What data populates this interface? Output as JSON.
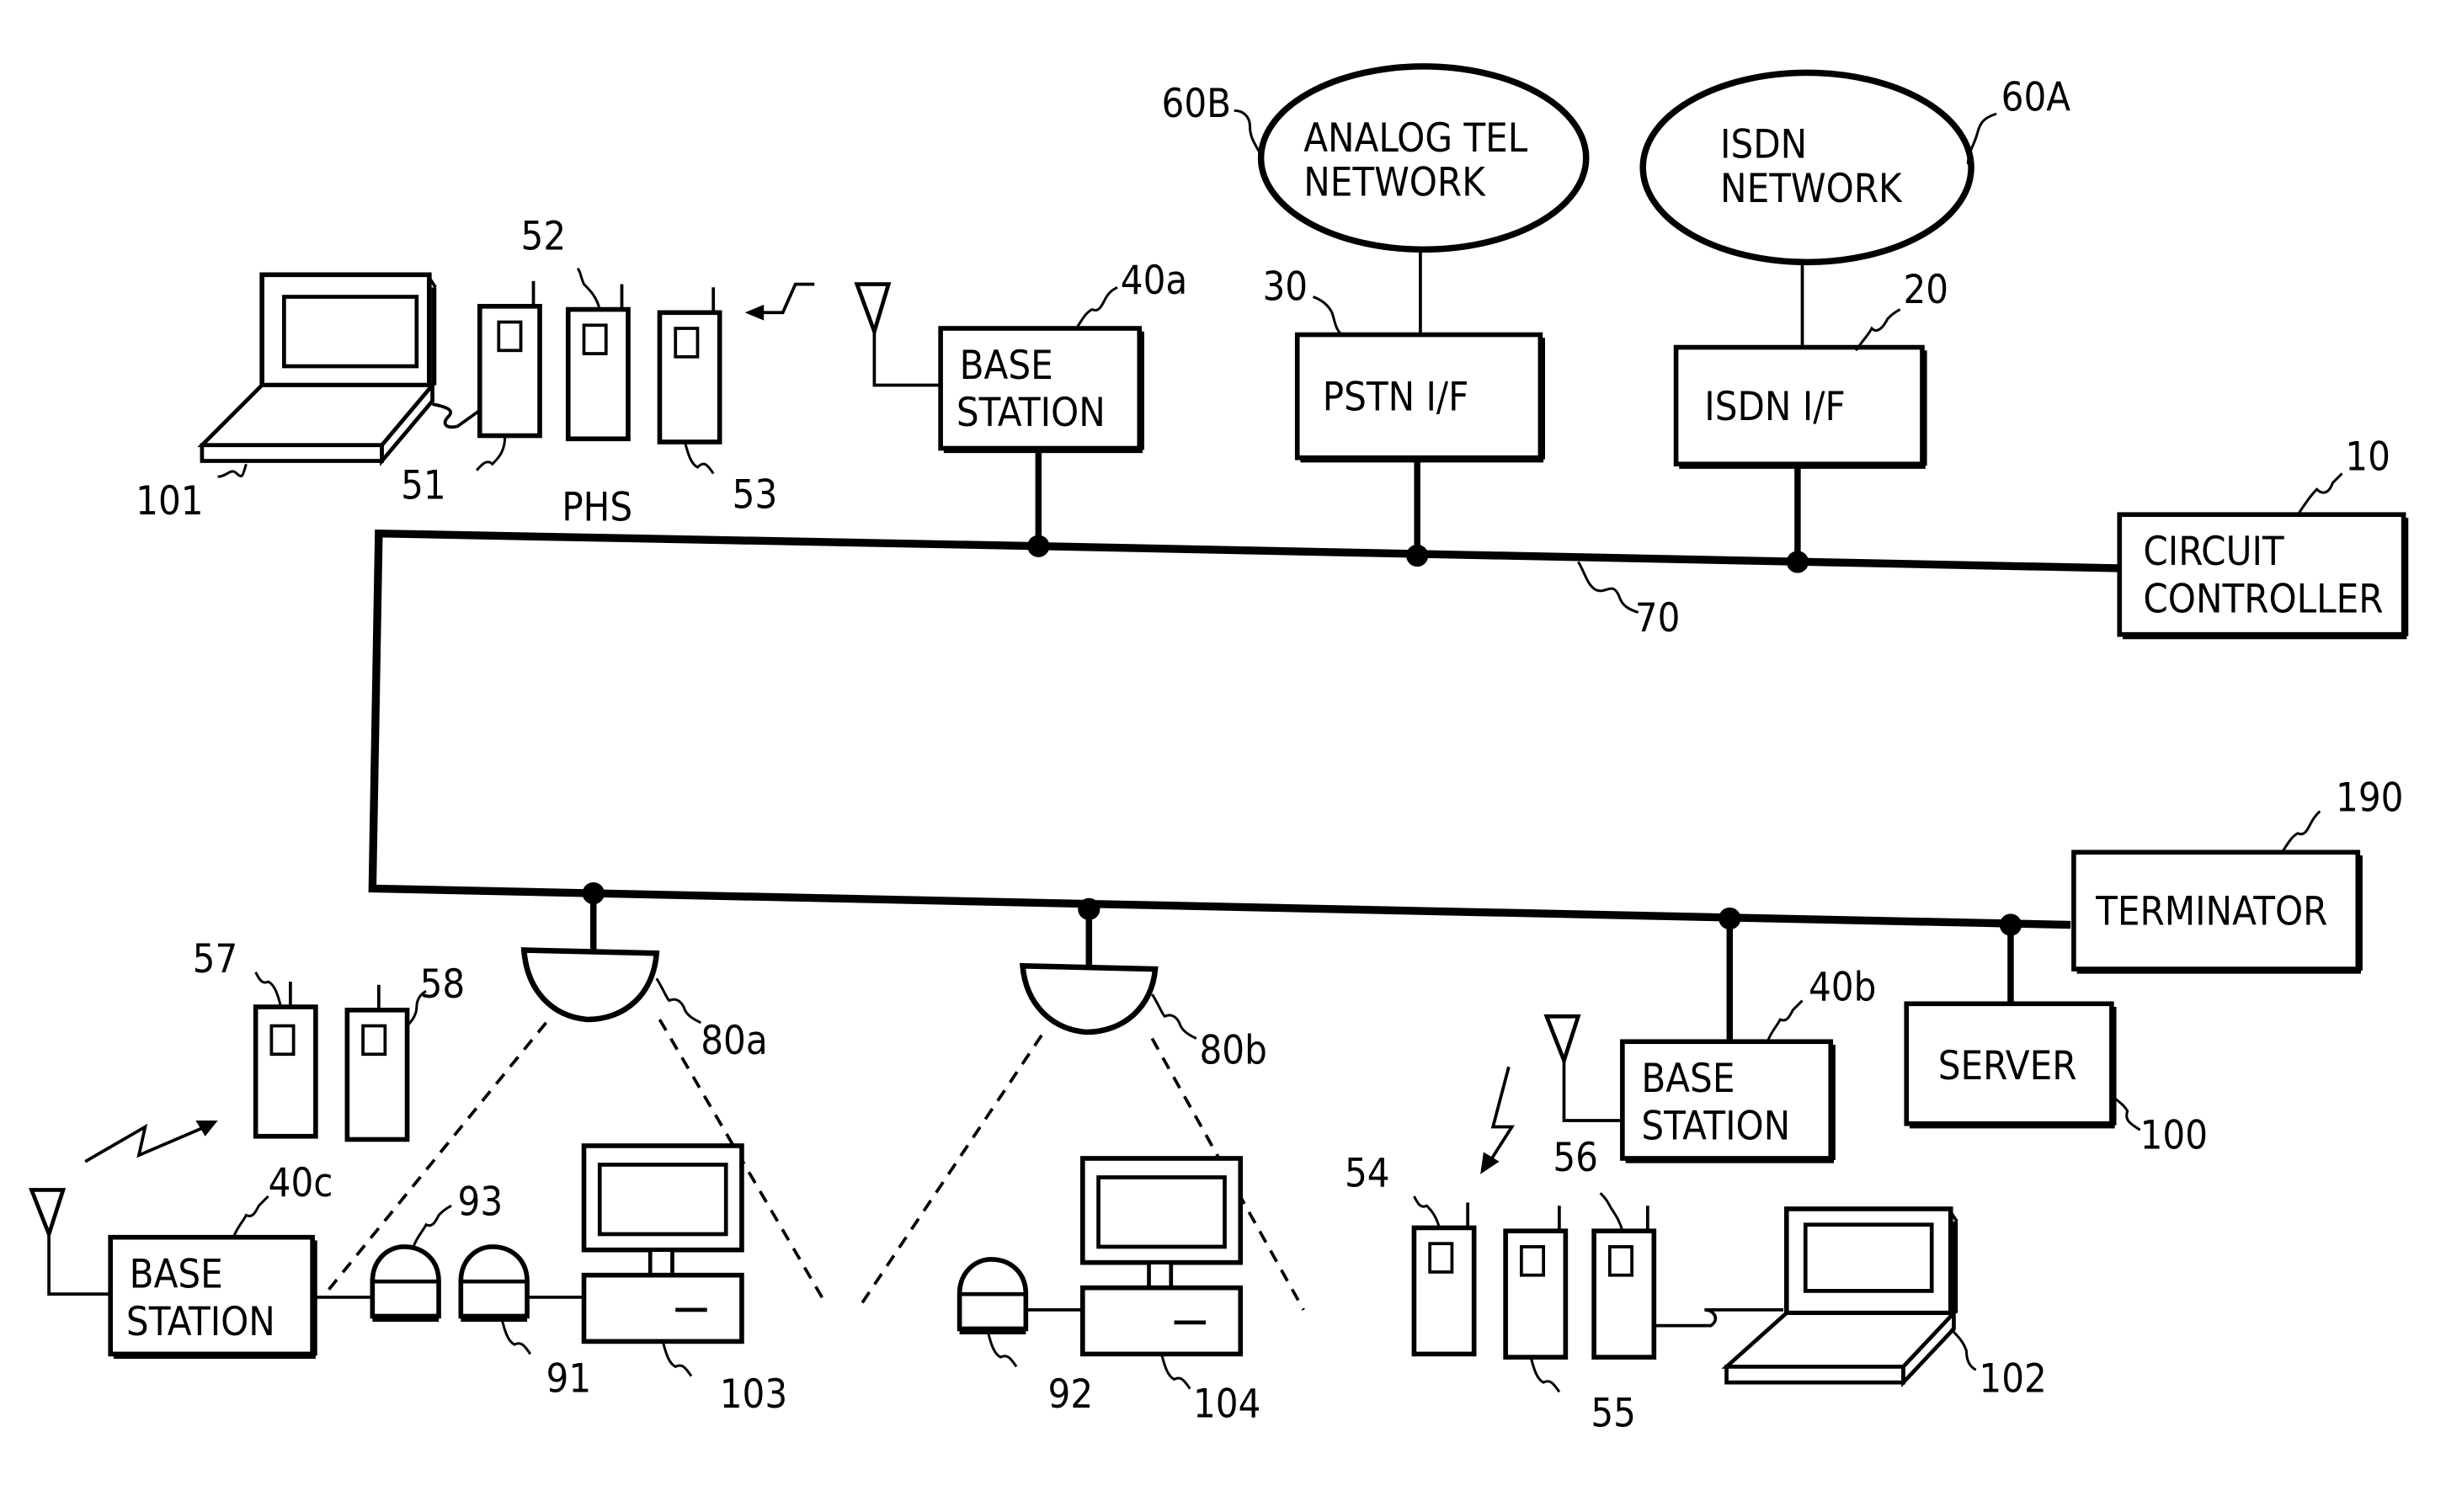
{
  "figure": {
    "type": "network block diagram",
    "bus_label": "70",
    "nodes": {
      "analog_net": {
        "ref": "60B",
        "lines": [
          "ANALOG TEL",
          "NETWORK"
        ]
      },
      "isdn_net": {
        "ref": "60A",
        "lines": [
          "ISDN",
          "NETWORK"
        ]
      },
      "pstn_if": {
        "ref": "30",
        "label": "PSTN I/F"
      },
      "isdn_if": {
        "ref": "20",
        "label": "ISDN I/F"
      },
      "circuit_controller": {
        "ref": "10",
        "lines": [
          "CIRCUIT",
          "CONTROLLER"
        ]
      },
      "terminator": {
        "ref": "190",
        "label": "TERMINATOR"
      },
      "server": {
        "ref": "100",
        "label": "SERVER"
      },
      "base_station_a": {
        "ref": "40a",
        "lines": [
          "BASE",
          "STATION"
        ]
      },
      "base_station_b": {
        "ref": "40b",
        "lines": [
          "BASE",
          "STATION"
        ]
      },
      "base_station_c": {
        "ref": "40c",
        "lines": [
          "BASE",
          "STATION"
        ]
      },
      "transceiver_a": {
        "ref": "80a"
      },
      "transceiver_b": {
        "ref": "80b"
      }
    },
    "phs_group_label": "PHS",
    "phones": {
      "p51": "51",
      "p52": "52",
      "p53": "53",
      "p54": "54",
      "p55": "55",
      "p56": "56",
      "p57": "57",
      "p58": "58"
    },
    "terminals": {
      "laptop_101": "101",
      "laptop_102": "102",
      "pc_103": "103",
      "pc_104": "104"
    },
    "adapters": {
      "a91": "91",
      "a92": "92",
      "a93": "93"
    }
  }
}
